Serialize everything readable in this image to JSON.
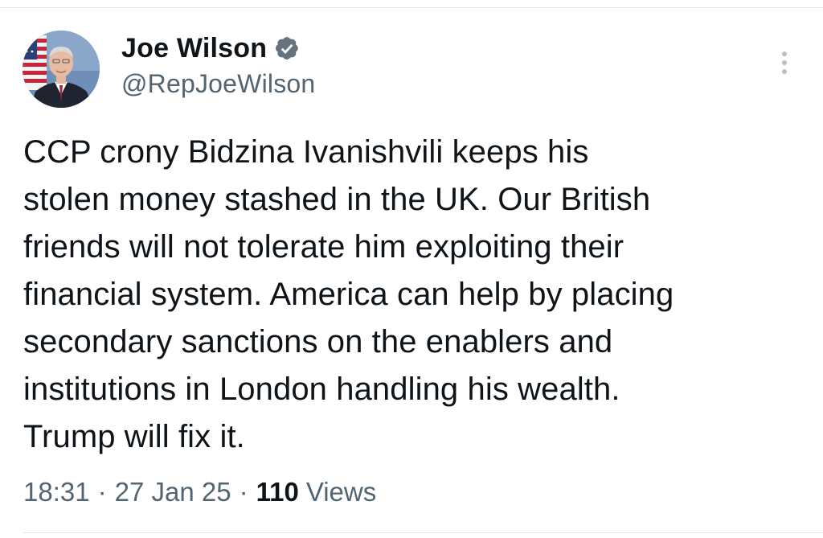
{
  "author": {
    "display_name": "Joe Wilson",
    "handle": "@RepJoeWilson",
    "verified": true
  },
  "tweet": {
    "text": "CCP crony Bidzina Ivanishvili keeps his\nstolen money stashed in the UK. Our British\nfriends will not tolerate him exploiting their\nfinancial system. America can help by placing\nsecondary sanctions on the enablers and\ninstitutions in London handling his wealth.\nTrump will fix it."
  },
  "meta": {
    "time": "18:31",
    "separator": "·",
    "date": "27 Jan 25",
    "views_count": "110",
    "views_label": "Views"
  },
  "icons": {
    "verified": "verified-badge-icon",
    "more": "more-vertical-icon"
  },
  "colors": {
    "text_primary": "#0f1419",
    "text_secondary": "#536471",
    "badge": "#66737f"
  }
}
